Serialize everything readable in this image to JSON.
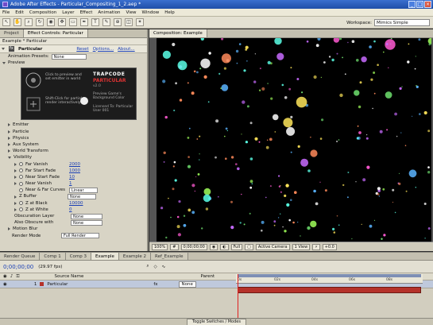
{
  "window": {
    "title": "Adobe After Effects - Particular_Compositing_1_2.aep *"
  },
  "menu": [
    "File",
    "Edit",
    "Composition",
    "Layer",
    "Effect",
    "Animation",
    "View",
    "Window",
    "Help"
  ],
  "toolbar": {
    "workspace_label": "Workspace:",
    "workspace_value": "Mimics Simple"
  },
  "left_panel": {
    "tabs": [
      "Project",
      "Effect Controls: Particular"
    ],
    "layer_path": "Example * Particular",
    "effect": {
      "name": "Particular",
      "reset": "Reset",
      "options": "Options...",
      "about": "About...",
      "presets_label": "Animation Presets:",
      "presets_value": "None"
    },
    "preview_label": "Preview",
    "logo": {
      "line1": "TRAPCODE",
      "line2": "PARTICULAR",
      "version": "v2.0",
      "click_text": "Click to preview and set emitter in world",
      "shift_text": "Shift-Click for partial render interactively",
      "register": "Preview Game's Background Color",
      "licensed": "Licensed To: Particular User 001"
    },
    "groups": [
      "Emitter",
      "Particle",
      "Physics",
      "Aux System",
      "World Transform",
      "Visibility"
    ],
    "visibility": {
      "far_vanish": {
        "label": "Far Vanish",
        "value": "2000"
      },
      "far_start": {
        "label": "Far Start Fade",
        "value": "1000"
      },
      "near_start": {
        "label": "Near Start Fade",
        "value": "10"
      },
      "near_vanish": {
        "label": "Near Vanish",
        "value": "1"
      },
      "near_far": {
        "label": "Near & Far Curves",
        "value": "Linear"
      },
      "zbuffer": {
        "label": "Z Buffer",
        "value": "None"
      },
      "zatblack": {
        "label": "Z at Black",
        "value": "10000"
      },
      "zatwhite": {
        "label": "Z at White",
        "value": "0"
      },
      "obscuration": {
        "label": "Obscuration Layer",
        "value": "None"
      },
      "also_obscure": {
        "label": "Also Obscure with",
        "value": "None"
      }
    },
    "motion_blur": "Motion Blur",
    "render_mode": {
      "label": "Render Mode",
      "value": "Full Render"
    }
  },
  "comp": {
    "tabs": [
      "Composition: Example"
    ],
    "zoom": "100%",
    "timecode": "0;00;00;00",
    "quality": "Full",
    "camera": "Active Camera",
    "views": "1 View",
    "exposure": "+0.0"
  },
  "timeline": {
    "tabs": [
      "Render Queue",
      "Comp 1",
      "Comp 3",
      "Example",
      "Example 2",
      "Ref_Example"
    ],
    "timecode": "0;00;00;00",
    "fps": "(29.97 fps)",
    "col_source": "Source Name",
    "col_parent": "Parent",
    "layer": {
      "num": "1",
      "name": "Particular",
      "parent": "None"
    },
    "ruler": [
      "0s",
      "02s",
      "04s",
      "06s",
      "08s"
    ],
    "footer": "Toggle Switches / Modes"
  },
  "colors": {
    "accent": "#3a6fcf",
    "bar": "#b5322a"
  }
}
